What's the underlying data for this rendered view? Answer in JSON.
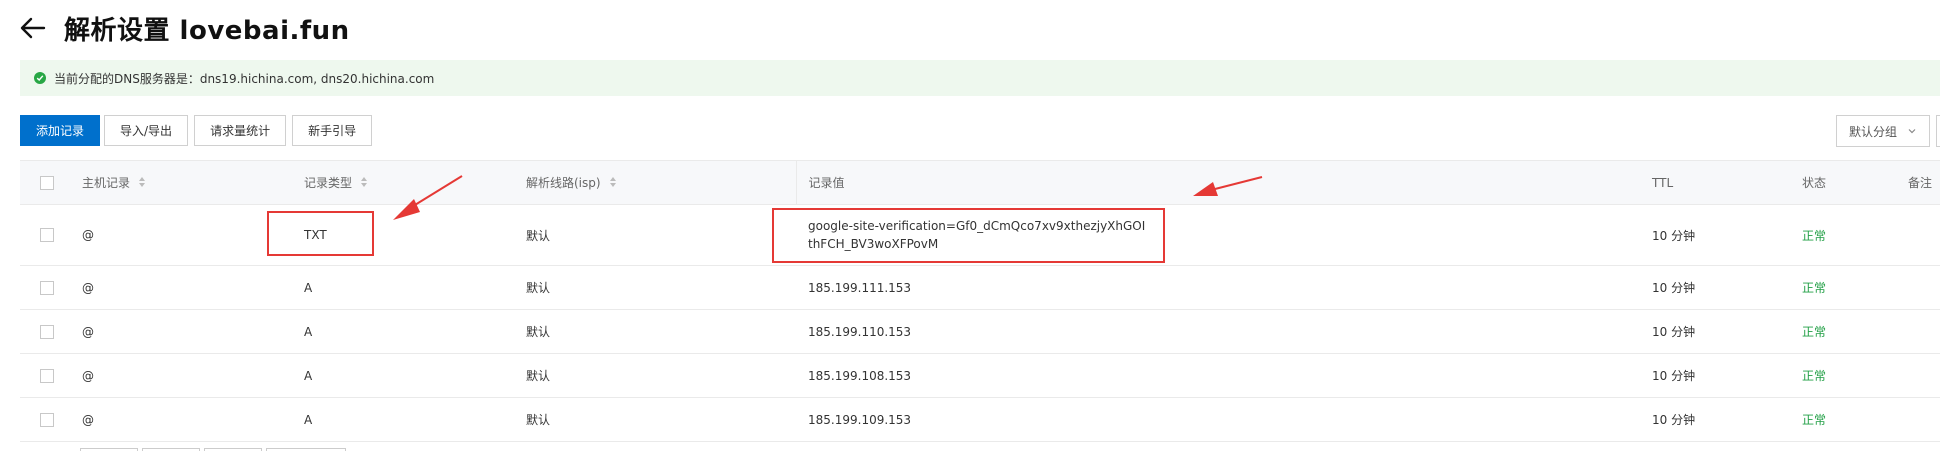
{
  "header": {
    "title": "解析设置 lovebai.fun"
  },
  "notice": {
    "text": "当前分配的DNS服务器是：dns19.hichina.com, dns20.hichina.com"
  },
  "toolbar": {
    "add": "添加记录",
    "import_export": "导入/导出",
    "stats": "请求量统计",
    "guide": "新手引导"
  },
  "group_select": {
    "value": "默认分组"
  },
  "table": {
    "headers": {
      "host": "主机记录",
      "type": "记录类型",
      "line": "解析线路(isp)",
      "value": "记录值",
      "ttl": "TTL",
      "status": "状态",
      "note": "备注"
    },
    "rows": [
      {
        "host": "@",
        "type": "TXT",
        "line": "默认",
        "value_line1": "google-site-verification=Gf0_dCmQco7xv9xthezjyXhGOI",
        "value_line2": "thFCH_BV3woXFPovM",
        "ttl": "10 分钟",
        "status": "正常"
      },
      {
        "host": "@",
        "type": "A",
        "line": "默认",
        "value": "185.199.111.153",
        "ttl": "10 分钟",
        "status": "正常"
      },
      {
        "host": "@",
        "type": "A",
        "line": "默认",
        "value": "185.199.110.153",
        "ttl": "10 分钟",
        "status": "正常"
      },
      {
        "host": "@",
        "type": "A",
        "line": "默认",
        "value": "185.199.108.153",
        "ttl": "10 分钟",
        "status": "正常"
      },
      {
        "host": "@",
        "type": "A",
        "line": "默认",
        "value": "185.199.109.153",
        "ttl": "10 分钟",
        "status": "正常"
      }
    ]
  },
  "colors": {
    "primary": "#0070cc",
    "status_ok": "#23a047",
    "annotation": "#e53935",
    "notice_bg": "#eef8ee"
  },
  "icons": {
    "back": "arrow-left-icon",
    "notice": "check-circle-icon",
    "sort": "sort-icon",
    "dropdown": "chevron-down-icon"
  }
}
